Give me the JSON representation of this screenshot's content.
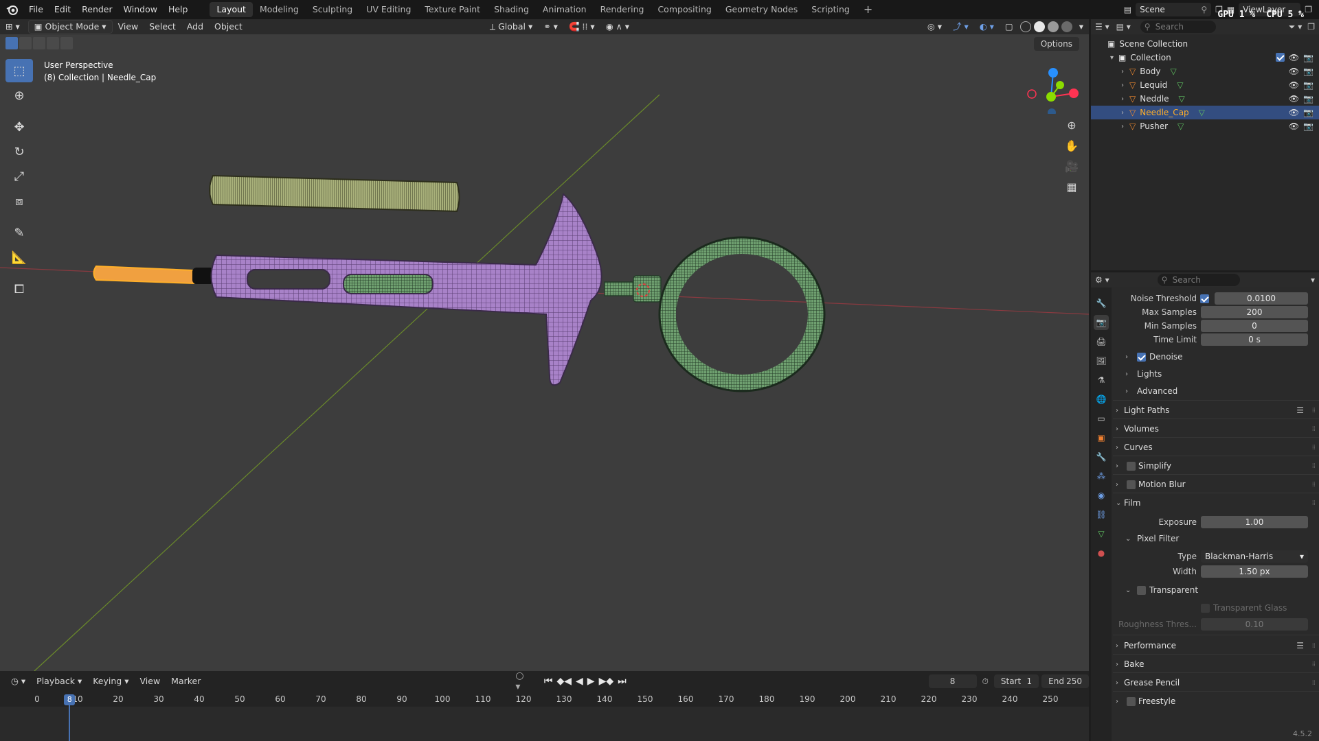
{
  "topbar": {
    "menus": [
      "File",
      "Edit",
      "Render",
      "Window",
      "Help"
    ],
    "workspaces": [
      "Layout",
      "Modeling",
      "Sculpting",
      "UV Editing",
      "Texture Paint",
      "Shading",
      "Animation",
      "Rendering",
      "Compositing",
      "Geometry Nodes",
      "Scripting"
    ],
    "active_workspace": "Layout",
    "scene": "Scene",
    "view_layer": "ViewLayer",
    "gpu": "GPU",
    "gpu_value": "1 %",
    "cpu": "CPU",
    "cpu_value": "5 %"
  },
  "viewport": {
    "mode": "Object Mode",
    "menus": [
      "View",
      "Select",
      "Add",
      "Object"
    ],
    "transform_orientation": "Global",
    "options": "Options",
    "info_line1": "User Perspective",
    "info_line2": "(8) Collection | Needle_Cap",
    "gizmo_axes": [
      "X",
      "Y",
      "Z"
    ]
  },
  "timeline": {
    "menus": [
      "Playback",
      "Keying",
      "View",
      "Marker"
    ],
    "current_frame": "8",
    "start_label": "Start",
    "start": "1",
    "end_label": "End",
    "end": "250",
    "ticks": [
      "0",
      "10",
      "20",
      "30",
      "40",
      "50",
      "60",
      "70",
      "80",
      "90",
      "100",
      "110",
      "120",
      "130",
      "140",
      "150",
      "160",
      "170",
      "180",
      "190",
      "200",
      "210",
      "220",
      "230",
      "240",
      "250"
    ],
    "playhead_label": "8"
  },
  "outliner": {
    "search_placeholder": "Search",
    "scene_collection": "Scene Collection",
    "collection": "Collection",
    "objects": [
      "Body",
      "Lequid",
      "Neddle",
      "Needle_Cap",
      "Pusher"
    ],
    "selected": "Needle_Cap"
  },
  "properties": {
    "search_placeholder": "Search",
    "noise_threshold_label": "Noise Threshold",
    "noise_threshold": "0.0100",
    "max_samples_label": "Max Samples",
    "max_samples": "200",
    "min_samples_label": "Min Samples",
    "min_samples": "0",
    "time_limit_label": "Time Limit",
    "time_limit": "0 s",
    "denoise": "Denoise",
    "lights": "Lights",
    "advanced": "Advanced",
    "panels": [
      "Light Paths",
      "Volumes",
      "Curves",
      "Simplify",
      "Motion Blur",
      "Film"
    ],
    "exposure_label": "Exposure",
    "exposure": "1.00",
    "pixel_filter": "Pixel Filter",
    "type_label": "Type",
    "type_value": "Blackman-Harris",
    "width_label": "Width",
    "width_value": "1.50 px",
    "transparent": "Transparent",
    "transparent_glass": "Transparent Glass",
    "roughness_label": "Roughness Thres...",
    "roughness_value": "0.10",
    "bottom_panels": [
      "Performance",
      "Bake",
      "Grease Pencil",
      "Freestyle"
    ]
  },
  "version": "4.5.2",
  "colors": {
    "accent": "#4772b3",
    "selection_orange": "#ffaf29",
    "axis_x": "#ff3352",
    "axis_y": "#8bdc00",
    "axis_z": "#2890ff"
  }
}
